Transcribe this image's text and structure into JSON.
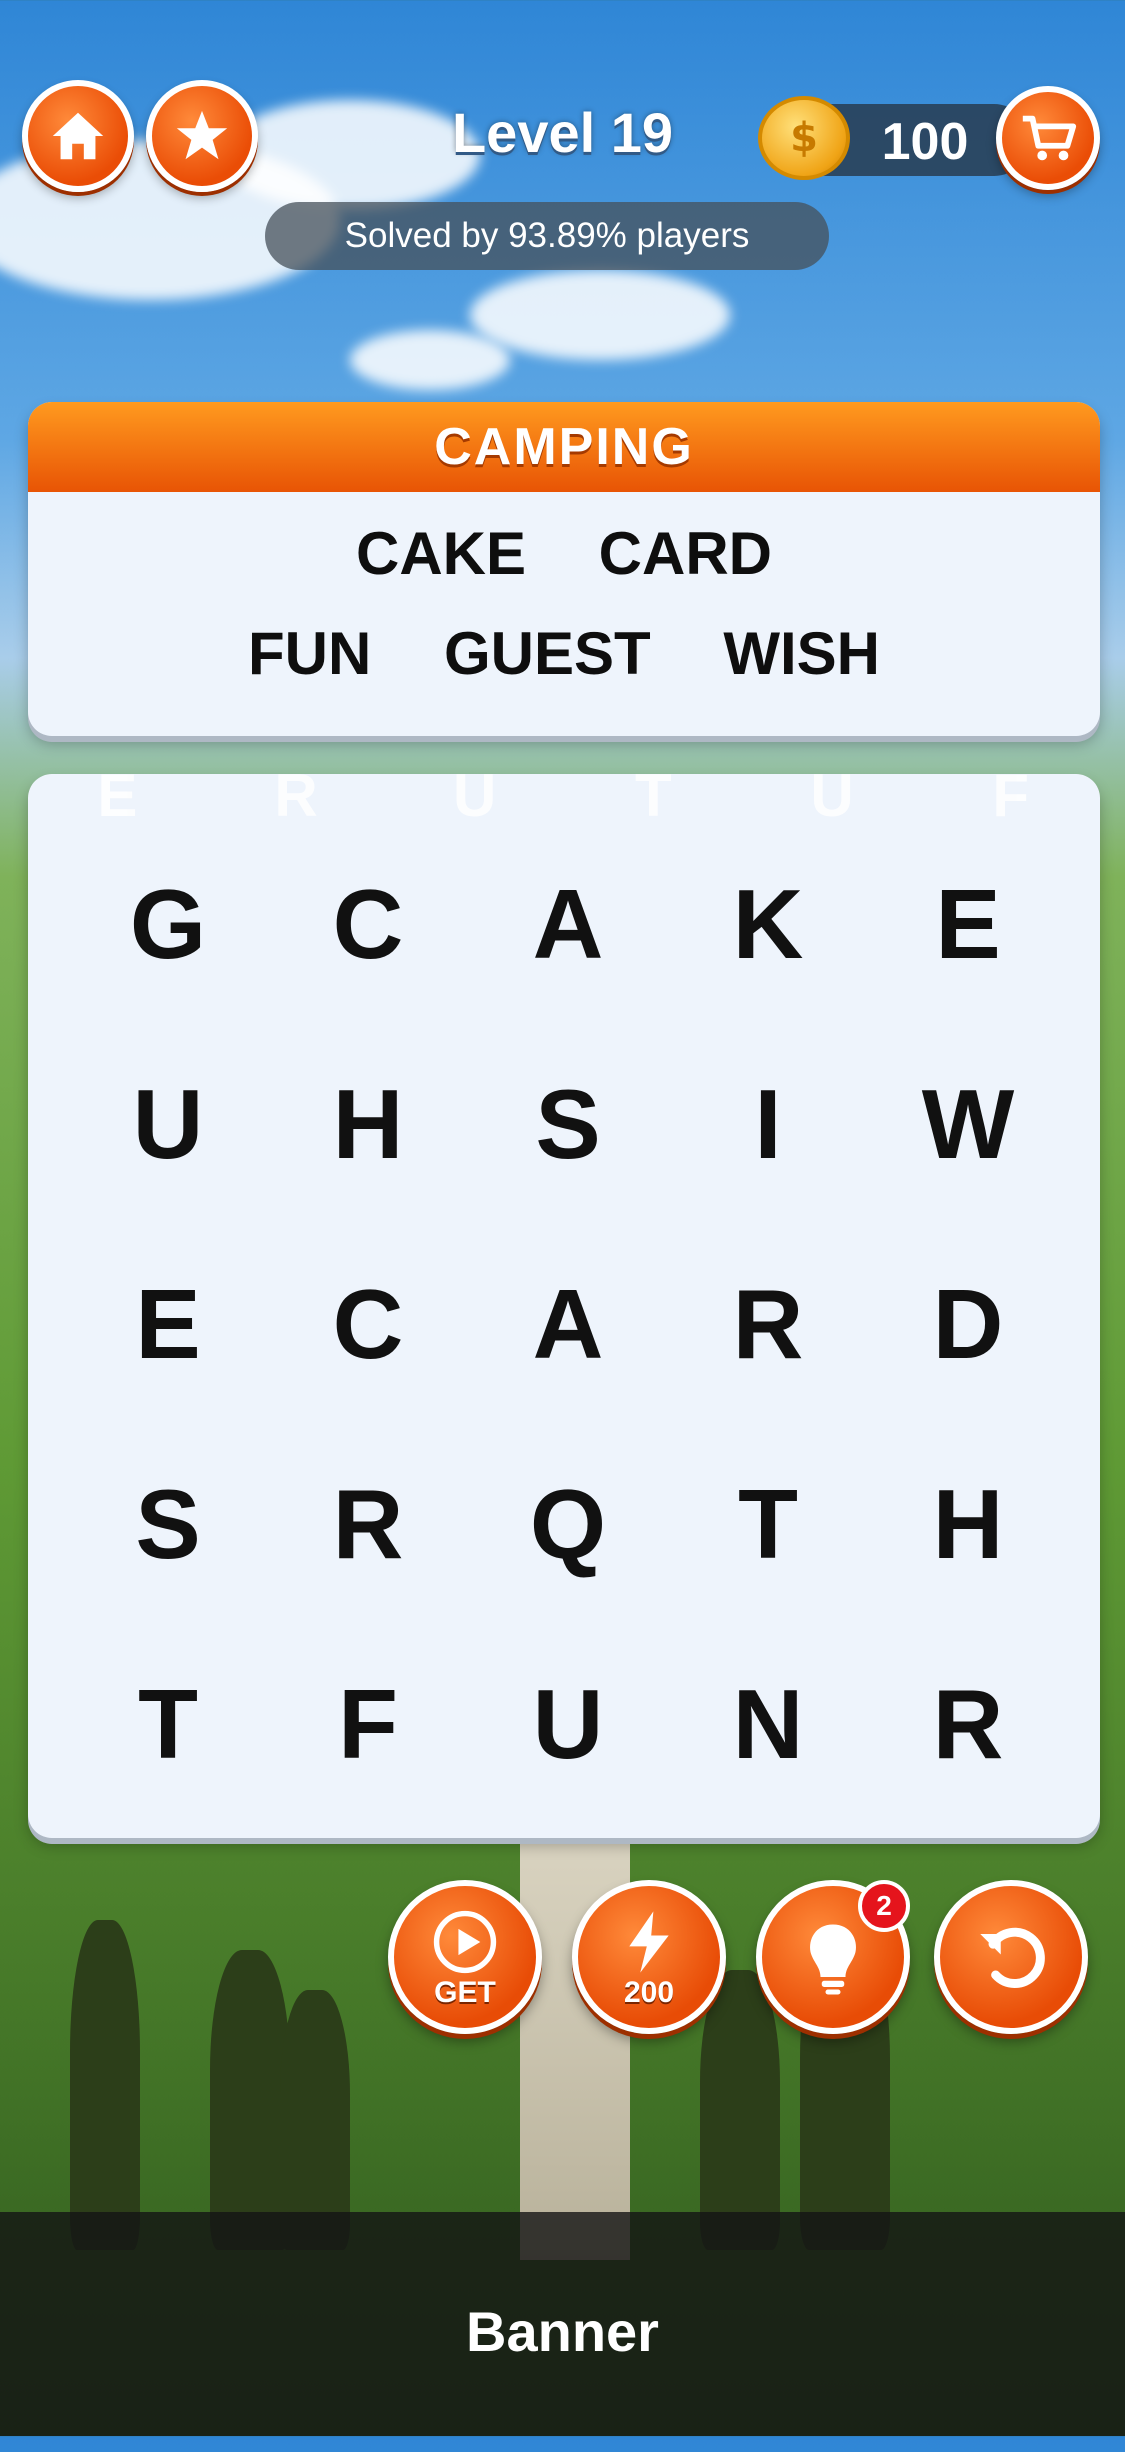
{
  "header": {
    "level_label": "Level 19",
    "solved_text": "Solved by 93.89% players",
    "coins": "100",
    "icons": [
      "home-icon",
      "star-icon",
      "coin-icon",
      "cart-icon"
    ]
  },
  "category": {
    "title": "CAMPING",
    "words_row1": [
      "CAKE",
      "CARD"
    ],
    "words_row2": [
      "FUN",
      "GUEST",
      "WISH"
    ]
  },
  "ghost_letters": [
    "E",
    "R",
    "U",
    "T",
    "U",
    "F"
  ],
  "grid": [
    [
      "G",
      "C",
      "A",
      "K",
      "E"
    ],
    [
      "U",
      "H",
      "S",
      "I",
      "W"
    ],
    [
      "E",
      "C",
      "A",
      "R",
      "D"
    ],
    [
      "S",
      "R",
      "Q",
      "T",
      "H"
    ],
    [
      "T",
      "F",
      "U",
      "N",
      "R"
    ]
  ],
  "tools": {
    "video_label": "GET",
    "bolt_cost": "200",
    "hint_badge": "2"
  },
  "banner": {
    "text": "Banner"
  },
  "colors": {
    "accent": "#e84c06",
    "panel": "#eef4fc"
  }
}
